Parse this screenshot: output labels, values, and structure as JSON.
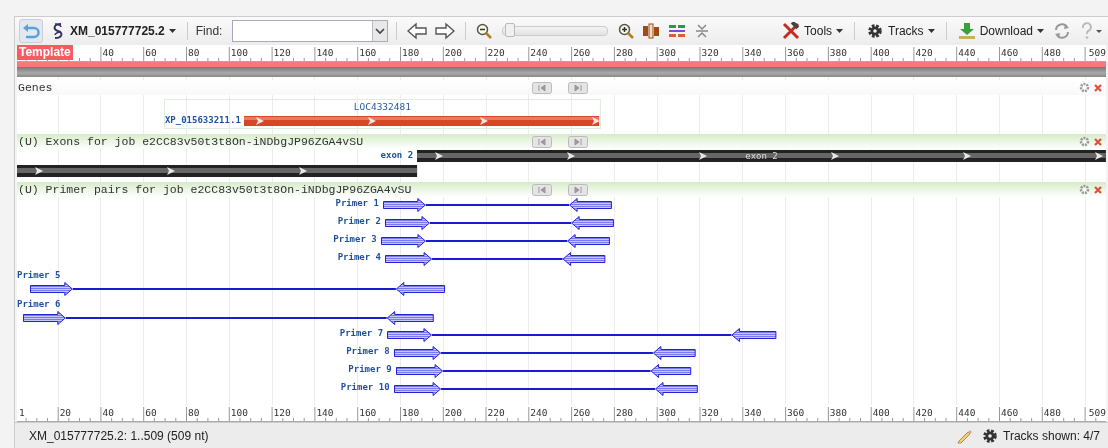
{
  "toolbar": {
    "accession": "XM_015777725.2",
    "find_label": "Find:",
    "zoom": {
      "level": 0.02
    },
    "menus": [
      "Tools",
      "Tracks",
      "Download"
    ]
  },
  "ruler_top": {
    "badge": "Template",
    "labels": [
      "40",
      "60",
      "80",
      "100",
      "120",
      "140",
      "160",
      "180",
      "200",
      "220",
      "240",
      "260",
      "280",
      "300",
      "320",
      "340",
      "360",
      "380",
      "400",
      "420",
      "440",
      "460",
      "480",
      "509"
    ]
  },
  "tracks": [
    {
      "kind": "gene",
      "title": "Genes",
      "features": [
        {
          "name": "LOC4332481",
          "product": "XP_015633211.1"
        }
      ]
    },
    {
      "kind": "exon",
      "title": "(U) Exons for job e2CC83v50t3t8On-iNDbgJP96ZGA4vSU",
      "features": [
        {
          "kind": "labeled",
          "label": "exon 2",
          "inner_label": "exon 2"
        },
        {
          "kind": "plain"
        }
      ]
    },
    {
      "kind": "primer",
      "title": "(U) Primer pairs for job e2CC83v50t3t8On-iNDbgJP96ZGA4vSU",
      "features": [
        {
          "label": "Primer 1"
        },
        {
          "label": "Primer 2"
        },
        {
          "label": "Primer 3"
        },
        {
          "label": "Primer 4"
        },
        {
          "label": "Primer 5"
        },
        {
          "label": "Primer 6"
        },
        {
          "label": "Primer 7"
        },
        {
          "label": "Primer 8"
        },
        {
          "label": "Primer 9"
        },
        {
          "label": "Primer 10"
        }
      ]
    }
  ],
  "ruler_bottom": {
    "labels": [
      "1",
      "20",
      "40",
      "60",
      "80",
      "100",
      "120",
      "140",
      "160",
      "180",
      "200",
      "220",
      "240",
      "260",
      "280",
      "300",
      "320",
      "340",
      "360",
      "380",
      "400",
      "420",
      "440",
      "460",
      "480",
      "509"
    ]
  },
  "status_bar": {
    "range": "XM_015777725.2: 1..509 (509 nt)",
    "tracks_shown": "Tracks shown: 4/7"
  }
}
